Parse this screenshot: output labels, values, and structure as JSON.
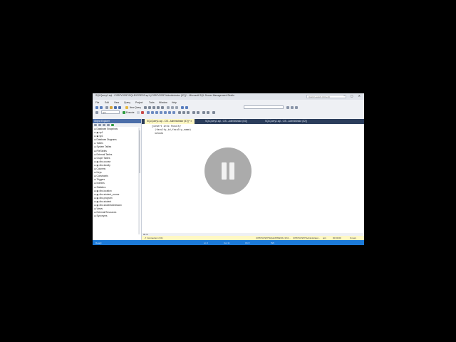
{
  "window": {
    "title": "SQLQuery1.sql - CIS57\\CIS57\\SQLEXPRESS.sp1 (CIS57\\CIS57\\Administrator (57))* - Microsoft SQL Server Management Studio",
    "quick_launch_placeholder": "Quick Launch (Ctrl+Q)",
    "buttons": "− ▢ ✕"
  },
  "menu": [
    "File",
    "Edit",
    "View",
    "Query",
    "Project",
    "Tools",
    "Window",
    "Help"
  ],
  "toolbar": {
    "new_query_label": "New Query",
    "database_combo": "sp1",
    "execute_label": "Execute"
  },
  "object_explorer": {
    "title": "Object Explorer",
    "tree": [
      "⊞ Database Snapshots",
      "⊟ ▣ sp1",
      "⊟ ▣ sp1",
      "  ⊞ Database Diagrams",
      "  ⊟ Tables",
      "    ⊞ System Tables",
      "    ⊞ FileTables",
      "    ⊞ External Tables",
      "    ⊞ Graph Tables",
      "    ⊞ ▦ dbo.course",
      "    ⊟ ▦ dbo.faculty",
      "      ⊞ Columns",
      "      ⊞ Keys",
      "      ⊞ Constraints",
      "      ⊞ Triggers",
      "      ⊞ Indexes",
      "      ⊞ Statistics",
      "    ⊞ ▦ dbo.location",
      "    ⊞ ▦ dbo.student_course",
      "    ⊞ ▦ dbo.program",
      "    ⊞ ▦ dbo.student",
      "    ⊞ ▦ dbo.studentAdmission",
      "  ⊞ Views",
      "  ⊞ External Resources",
      "  ⊞ Synonyms"
    ]
  },
  "tabs": [
    {
      "label": "SQLQuery1.sql - CIS...Administrator (57))*  ✕",
      "active": true
    },
    {
      "label": "SQLQuery1.sql - CIS...Administrator (64))",
      "active": false
    },
    {
      "label": "SQLQuery1.sql - CIS...Administrator (52))",
      "active": false
    }
  ],
  "editor": {
    "code": "□insert into faculty\n  (faculty_id,faculty_name)\n  values"
  },
  "zoom": "96 %",
  "status": {
    "connected": "✔ Connected. (1/1)",
    "server": "CIS57\\CIS57\\SQLEXPRESS (15.0...",
    "user": "CIS57\\CIS57\\Administrator...",
    "db": "sp1",
    "time": "00:00:00",
    "rows": "0 rows"
  },
  "bottom": {
    "left": "Ready",
    "ln": "Ln 3",
    "col": "Col 11",
    "ch": "Ch 8",
    "ins": "INS"
  },
  "colors": {
    "accent": "#1c7ad8",
    "tab_active": "#fff8c4",
    "explorer_header": "#4b6ea9"
  },
  "overlay": {
    "icon": "pause-icon"
  }
}
